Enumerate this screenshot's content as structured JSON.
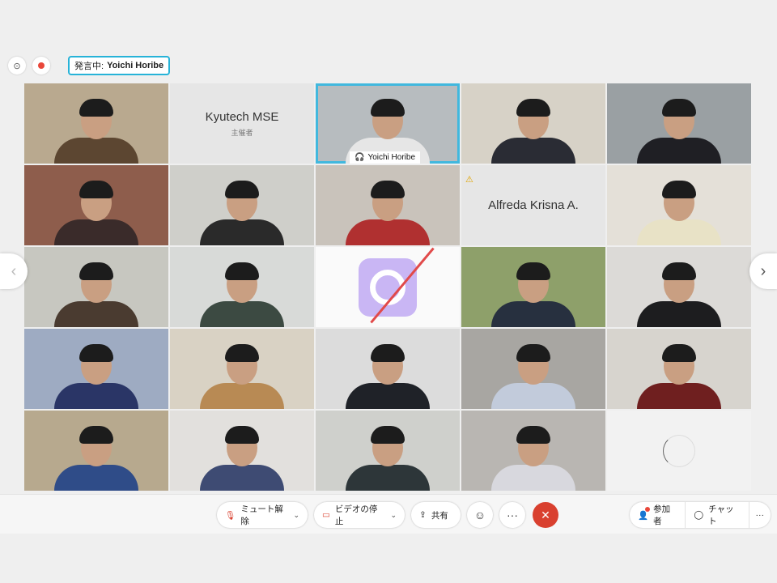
{
  "top": {
    "speaking_label": "発言中:",
    "speaker_name": "Yoichi Horibe"
  },
  "tiles": [
    {
      "type": "video",
      "bg": "#b9a98f",
      "shirt": "#5c4631"
    },
    {
      "type": "text",
      "name": "Kyutech MSE",
      "sub": "主催者"
    },
    {
      "type": "video",
      "bg": "#b7bcbf",
      "shirt": "#e6e6e6",
      "active": true,
      "label": "Yoichi Horibe"
    },
    {
      "type": "video",
      "bg": "#d7d2c7",
      "shirt": "#2a2c34"
    },
    {
      "type": "video",
      "bg": "#9aa0a3",
      "shirt": "#1f1f24"
    },
    {
      "type": "video",
      "bg": "#8e5d4c",
      "shirt": "#3a2b2a"
    },
    {
      "type": "video",
      "bg": "#cfcfca",
      "shirt": "#2a2a2a"
    },
    {
      "type": "video",
      "bg": "#c9c3bb",
      "shirt": "#b03030"
    },
    {
      "type": "text",
      "name": "Alfreda Krisna A.",
      "warn": true
    },
    {
      "type": "video",
      "bg": "#e4e0d8",
      "shirt": "#e8e2c6"
    },
    {
      "type": "video",
      "bg": "#c7c7c0",
      "shirt": "#4a3b30"
    },
    {
      "type": "video",
      "bg": "#d8dad8",
      "shirt": "#3c4a42"
    },
    {
      "type": "camoff"
    },
    {
      "type": "video",
      "bg": "#8ea06a",
      "shirt": "#27303f"
    },
    {
      "type": "video",
      "bg": "#dcdad7",
      "shirt": "#1d1d1f"
    },
    {
      "type": "video",
      "bg": "#9eabc2",
      "shirt": "#2a3566"
    },
    {
      "type": "video",
      "bg": "#d9d2c4",
      "shirt": "#b88a54"
    },
    {
      "type": "video",
      "bg": "#dcdcdc",
      "shirt": "#1f2228"
    },
    {
      "type": "video",
      "bg": "#a8a6a2",
      "shirt": "#c2cbdb"
    },
    {
      "type": "video",
      "bg": "#d7d4ce",
      "shirt": "#6f1f1f"
    },
    {
      "type": "video",
      "bg": "#b7a98e",
      "shirt": "#2f4c88"
    },
    {
      "type": "video",
      "bg": "#e2e0dd",
      "shirt": "#3e4b73"
    },
    {
      "type": "video",
      "bg": "#cfd0cc",
      "shirt": "#2d3639"
    },
    {
      "type": "video",
      "bg": "#b9b6b2",
      "shirt": "#d8d8de"
    },
    {
      "type": "loading"
    }
  ],
  "toolbar": {
    "unmute_label": "ミュート解除",
    "stop_video_label": "ビデオの停止",
    "share_label": "共有",
    "participants_label": "参加者",
    "chat_label": "チャット"
  }
}
